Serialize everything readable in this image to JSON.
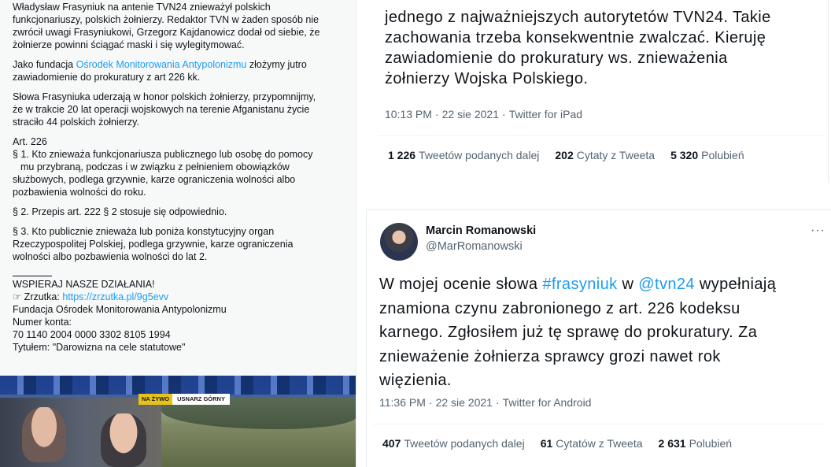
{
  "left_post": {
    "para1": [
      "Władysław Frasyniuk na antenie TVN24 znieważył polskich",
      "funkcjonariuszy, polskich żołnierzy. Redaktor TVN w żaden sposób nie",
      "zwrócił uwagi Frasyniukowi, Grzegorz Kajdanowicz dodał od siebie, że",
      "żołnierze powinni ściągać maski i się wylegitymować."
    ],
    "para2_prefix": "Jako fundacja ",
    "para2_link": "Ośrodek Monitorowania Antypolonizmu",
    "para2_suffix": " złożymy jutro",
    "para2_line2": "zawiadomienie do prokuratury z art 226 kk.",
    "para3": [
      "Słowa Frasyniuka uderzają w honor polskich żołnierzy, przypomnijmy,",
      "że w trakcie 20 lat operacji wojskowych na terenie Afganistanu życie",
      "straciło 44 polskich żołnierzy."
    ],
    "art_title": "Art. 226",
    "art_p1": [
      "§ 1. Kto znieważa funkcjonariusza publicznego lub osobę do pomocy",
      "mu przybraną, podczas i w związku z pełnieniem obowiązków",
      "służbowych, podlega grzywnie, karze ograniczenia wolności albo",
      "pozbawienia wolności do roku."
    ],
    "art_p2": "§ 2. Przepis art. 222 § 2 stosuje się odpowiednio.",
    "art_p3": [
      "§ 3. Kto publicznie znieważa lub poniża konstytucyjny organ",
      "Rzeczypospolitej Polskiej, podlega grzywnie, karze ograniczenia",
      "wolności albo pozbawienia wolności do lat 2."
    ],
    "support_heading": "WSPIERAJ NASZE DZIAŁANIA!",
    "zrzutka_prefix": "☞ Zrzutka: ",
    "zrzutka_link": "https://zrzutka.pl/9g5evv",
    "foundation": "Fundacja Ośrodek Monitorowania Antypolonizmu",
    "account_label": "Numer konta:",
    "account_number": "70 1140 2004 0000 3302 8105 1994",
    "title_line": "Tytułem: \"Darowizna na cele statutowe\""
  },
  "tv_image": {
    "live_label": "NA ŻYWO",
    "location_label": "USNARZ GÓRNY"
  },
  "tweet1": {
    "text_lines": [
      "jednego z najważniejszych autorytetów TVN24. Takie",
      "zachowania trzeba  konsekwentnie zwalczać. Kieruję",
      "zawiadomienie do prokuratury ws. znieważenia",
      "żołnierzy Wojska Polskiego."
    ],
    "time": "10:13 PM",
    "date": "22 sie 2021",
    "source": "Twitter for iPad",
    "retweets_count": "1 226",
    "retweets_label": "Tweetów podanych dalej",
    "quotes_count": "202",
    "quotes_label": "Cytaty z Tweeta",
    "likes_count": "5 320",
    "likes_label": "Polubień"
  },
  "tweet2": {
    "author_name": "Marcin Romanowski",
    "author_handle": "@MarRomanowski",
    "more": "···",
    "line1_a": "W mojej ocenie słowa ",
    "line1_hashtag": "#frasyniuk",
    "line1_b": " w ",
    "line1_mention": "@tvn24",
    "line1_c": " wypełniają",
    "text_lines": [
      "znamiona czynu zabronionego z art. 226 kodeksu",
      "karnego. Zgłosiłem już tę sprawę do prokuratury. Za",
      "znieważenie żołnierza sprawcy grozi nawet rok",
      "więzienia."
    ],
    "time": "11:36 PM",
    "date": "22 sie 2021",
    "source": "Twitter for Android",
    "retweets_count": "407",
    "retweets_label": "Tweetów podanych dalej",
    "quotes_count": "61",
    "quotes_label": "Cytatów z Tweeta",
    "likes_count": "2 631",
    "likes_label": "Polubień"
  },
  "colors": {
    "accent": "#1d9bf0",
    "text": "#0f1419",
    "muted": "#536471"
  }
}
